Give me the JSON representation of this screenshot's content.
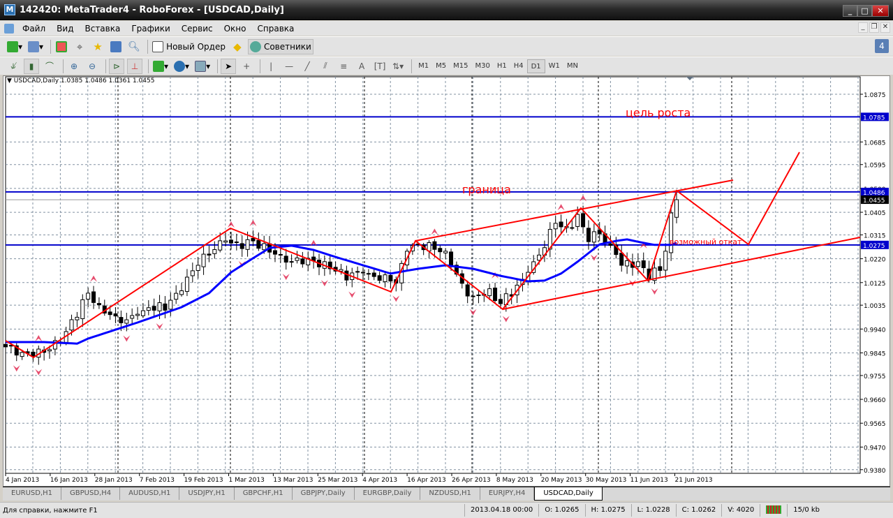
{
  "window": {
    "title": "142420: MetaTrader4 - RoboForex - [USDCAD,Daily]"
  },
  "menu": [
    "Файл",
    "Вид",
    "Вставка",
    "Графики",
    "Сервис",
    "Окно",
    "Справка"
  ],
  "toolbar": {
    "new_order": "Новый Ордер",
    "experts": "Советники",
    "notifications_count": "4"
  },
  "timeframes": [
    "M1",
    "M5",
    "M15",
    "M30",
    "H1",
    "H4",
    "D1",
    "W1",
    "MN"
  ],
  "active_timeframe": "D1",
  "chart": {
    "symbol_info": "USDCAD,Daily  1.0385 1.0486 1.0361 1.0455",
    "annotations": {
      "target": "цель роста",
      "border": "граница",
      "pullback": "возможный откат"
    },
    "price_labels": [
      "1.0875",
      "1.0685",
      "1.0595",
      "1.0500",
      "1.0405",
      "1.0315",
      "1.0220",
      "1.0125",
      "1.0035",
      "0.9940",
      "0.9845",
      "0.9755",
      "0.9660",
      "0.9565",
      "0.9470",
      "0.9380"
    ],
    "hlines": [
      {
        "price": 1.0785,
        "label": "1.0785",
        "color": "#0000cc"
      },
      {
        "price": 1.0486,
        "label": "1.0486",
        "color": "#0000cc"
      },
      {
        "price": 1.0275,
        "label": "1.0275",
        "color": "#0000cc"
      }
    ],
    "bid": {
      "price": 1.0455,
      "label": "1.0455"
    },
    "date_labels": [
      "4 Jan 2013",
      "16 Jan 2013",
      "28 Jan 2013",
      "7 Feb 2013",
      "19 Feb 2013",
      "1 Mar 2013",
      "13 Mar 2013",
      "25 Mar 2013",
      "4 Apr 2013",
      "16 Apr 2013",
      "26 Apr 2013",
      "8 May 2013",
      "20 May 2013",
      "30 May 2013",
      "11 Jun 2013",
      "21 Jun 2013"
    ],
    "close_anchors": [
      [
        0,
        0.9869
      ],
      [
        5,
        0.9832
      ],
      [
        10,
        0.9888
      ],
      [
        15,
        1.0083
      ],
      [
        18,
        1.0013
      ],
      [
        22,
        0.9971
      ],
      [
        26,
        1.0027
      ],
      [
        29,
        1.0027
      ],
      [
        32,
        1.011
      ],
      [
        36,
        1.0222
      ],
      [
        40,
        1.0291
      ],
      [
        42,
        1.0272
      ],
      [
        45,
        1.0291
      ],
      [
        47,
        1.0263
      ],
      [
        50,
        1.0236
      ],
      [
        52,
        1.0208
      ],
      [
        55,
        1.0222
      ],
      [
        59,
        1.018
      ],
      [
        62,
        1.0152
      ],
      [
        65,
        1.0166
      ],
      [
        69,
        1.0138
      ],
      [
        71,
        1.0124
      ],
      [
        73,
        1.025
      ],
      [
        75,
        1.0277
      ],
      [
        78,
        1.0263
      ],
      [
        80,
        1.025
      ],
      [
        83,
        1.011
      ],
      [
        85,
        1.0069
      ],
      [
        88,
        1.0083
      ],
      [
        90,
        1.0041
      ],
      [
        93,
        1.011
      ],
      [
        96,
        1.0194
      ],
      [
        98,
        1.0277
      ],
      [
        100,
        1.0361
      ],
      [
        102,
        1.0333
      ],
      [
        104,
        1.0389
      ],
      [
        106,
        1.0305
      ],
      [
        108,
        1.0319
      ],
      [
        111,
        1.025
      ],
      [
        112,
        1.0194
      ],
      [
        115,
        1.0208
      ],
      [
        117,
        1.0152
      ],
      [
        119,
        1.018
      ],
      [
        120,
        1.025
      ],
      [
        121,
        1.0385
      ],
      [
        122,
        1.0455
      ]
    ],
    "last_bar": {
      "open": 1.0385,
      "high": 1.0486,
      "low": 1.0361,
      "close": 1.0455
    },
    "ma_anchors": [
      [
        0,
        0.9888
      ],
      [
        7,
        0.9888
      ],
      [
        13,
        0.9882
      ],
      [
        15,
        0.9902
      ],
      [
        24,
        0.9966
      ],
      [
        32,
        1.0027
      ],
      [
        37,
        1.0083
      ],
      [
        41,
        1.0166
      ],
      [
        45,
        1.0222
      ],
      [
        48,
        1.0263
      ],
      [
        52,
        1.0272
      ],
      [
        56,
        1.0255
      ],
      [
        60,
        1.0227
      ],
      [
        65,
        1.0194
      ],
      [
        70,
        1.0161
      ],
      [
        75,
        1.018
      ],
      [
        80,
        1.0194
      ],
      [
        85,
        1.018
      ],
      [
        90,
        1.0152
      ],
      [
        95,
        1.013
      ],
      [
        98,
        1.0133
      ],
      [
        101,
        1.0161
      ],
      [
        104,
        1.0208
      ],
      [
        108,
        1.0277
      ],
      [
        111,
        1.0291
      ],
      [
        113,
        1.0297
      ],
      [
        116,
        1.0283
      ],
      [
        118,
        1.0275
      ],
      [
        121,
        1.0275
      ],
      [
        122,
        1.0283
      ]
    ],
    "colors": {
      "bull": "#ffffff",
      "bear": "#000000",
      "ma": "#0000ff",
      "drawings": "#ff0000",
      "fractal": "#e0204a"
    }
  },
  "tabs": [
    "EURUSD,H1",
    "GBPUSD,H4",
    "AUDUSD,H1",
    "USDJPY,H1",
    "GBPCHF,H1",
    "GBPJPY,Daily",
    "EURGBP,Daily",
    "NZDUSD,H1",
    "EURJPY,H4",
    "USDCAD,Daily"
  ],
  "active_tab": "USDCAD,Daily",
  "status": {
    "help": "Для справки, нажмите F1",
    "datetime": "2013.04.18 00:00",
    "open": "O: 1.0265",
    "high": "H: 1.0275",
    "low": "L: 1.0228",
    "close": "C: 1.0262",
    "volume": "V: 4020",
    "traffic": "15/0 kb"
  }
}
